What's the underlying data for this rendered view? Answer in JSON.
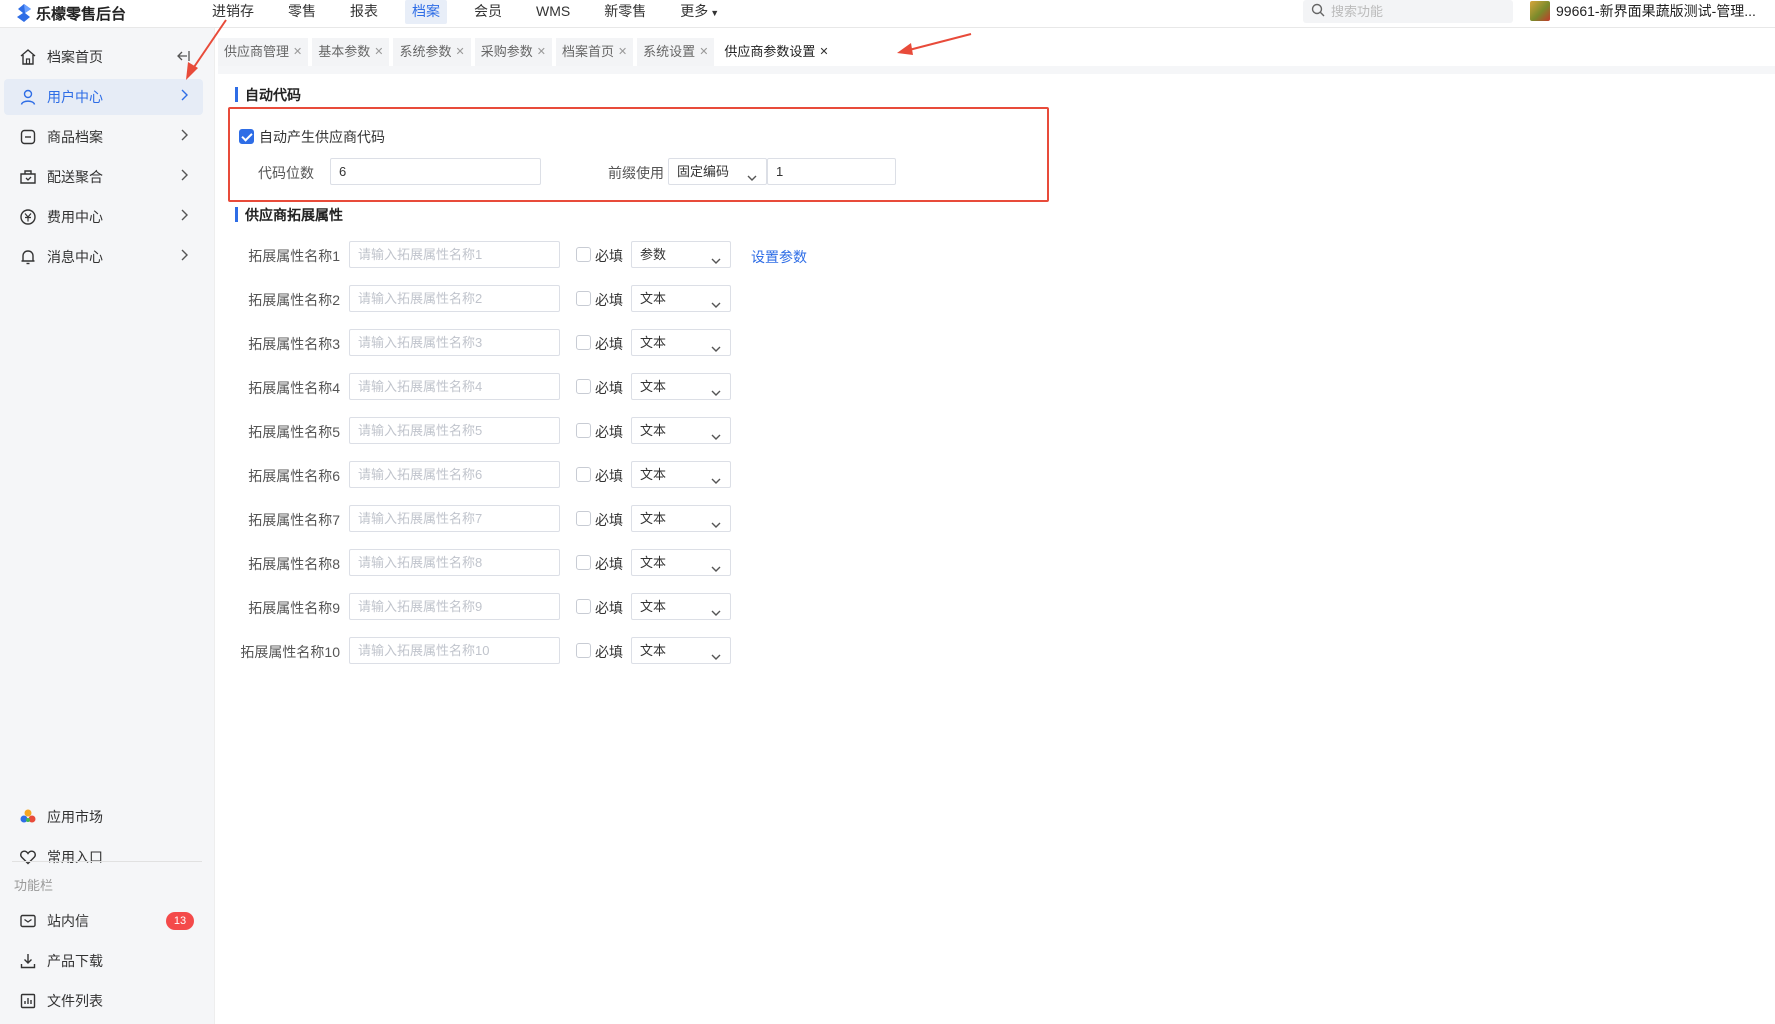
{
  "app": {
    "title": "乐檬零售后台"
  },
  "topnav": {
    "items": [
      {
        "label": "进销存",
        "active": false
      },
      {
        "label": "零售",
        "active": false
      },
      {
        "label": "报表",
        "active": false
      },
      {
        "label": "档案",
        "active": true
      },
      {
        "label": "会员",
        "active": false
      },
      {
        "label": "WMS",
        "active": false
      },
      {
        "label": "新零售",
        "active": false
      },
      {
        "label": "更多",
        "active": false,
        "dropdown": true
      }
    ],
    "search_placeholder": "搜索功能",
    "user_label": "99661-新界面果蔬版测试-管理..."
  },
  "sidebar": {
    "items": [
      {
        "label": "档案首页",
        "icon": "home-icon"
      },
      {
        "label": "用户中心",
        "icon": "user-icon",
        "active": true
      },
      {
        "label": "商品档案",
        "icon": "goods-icon"
      },
      {
        "label": "配送聚合",
        "icon": "delivery-icon"
      },
      {
        "label": "费用中心",
        "icon": "fee-icon"
      },
      {
        "label": "消息中心",
        "icon": "bell-icon"
      }
    ],
    "bottom_items": [
      {
        "label": "应用市场",
        "icon": "app-market-icon"
      },
      {
        "label": "常用入口",
        "icon": "heart-icon"
      }
    ],
    "section_label": "功能栏",
    "function_items": [
      {
        "label": "站内信",
        "icon": "mail-icon",
        "badge": "13"
      },
      {
        "label": "产品下载",
        "icon": "download-icon"
      },
      {
        "label": "文件列表",
        "icon": "file-list-icon"
      }
    ]
  },
  "tabs": [
    {
      "label": "供应商管理",
      "active": false
    },
    {
      "label": "基本参数",
      "active": false
    },
    {
      "label": "系统参数",
      "active": false
    },
    {
      "label": "采购参数",
      "active": false
    },
    {
      "label": "档案首页",
      "active": false
    },
    {
      "label": "系统设置",
      "active": false
    },
    {
      "label": "供应商参数设置",
      "active": true
    }
  ],
  "auto_code": {
    "section_title": "自动代码",
    "checkbox_label": "自动产生供应商代码",
    "checked": true,
    "digits_label": "代码位数",
    "digits_value": "6",
    "prefix_label": "前缀使用",
    "prefix_select": "固定编码",
    "prefix_value": "1"
  },
  "ext": {
    "section_title": "供应商拓展属性",
    "required_label": "必填",
    "set_param_link": "设置参数",
    "rows": [
      {
        "label": "拓展属性名称1",
        "placeholder": "请输入拓展属性名称1",
        "type": "参数"
      },
      {
        "label": "拓展属性名称2",
        "placeholder": "请输入拓展属性名称2",
        "type": "文本"
      },
      {
        "label": "拓展属性名称3",
        "placeholder": "请输入拓展属性名称3",
        "type": "文本"
      },
      {
        "label": "拓展属性名称4",
        "placeholder": "请输入拓展属性名称4",
        "type": "文本"
      },
      {
        "label": "拓展属性名称5",
        "placeholder": "请输入拓展属性名称5",
        "type": "文本"
      },
      {
        "label": "拓展属性名称6",
        "placeholder": "请输入拓展属性名称6",
        "type": "文本"
      },
      {
        "label": "拓展属性名称7",
        "placeholder": "请输入拓展属性名称7",
        "type": "文本"
      },
      {
        "label": "拓展属性名称8",
        "placeholder": "请输入拓展属性名称8",
        "type": "文本"
      },
      {
        "label": "拓展属性名称9",
        "placeholder": "请输入拓展属性名称9",
        "type": "文本"
      },
      {
        "label": "拓展属性名称10",
        "placeholder": "请输入拓展属性名称10",
        "type": "文本"
      }
    ]
  },
  "colors": {
    "accent": "#2e6de6",
    "annotation": "#e84b3a",
    "badge": "#f44a4a"
  }
}
